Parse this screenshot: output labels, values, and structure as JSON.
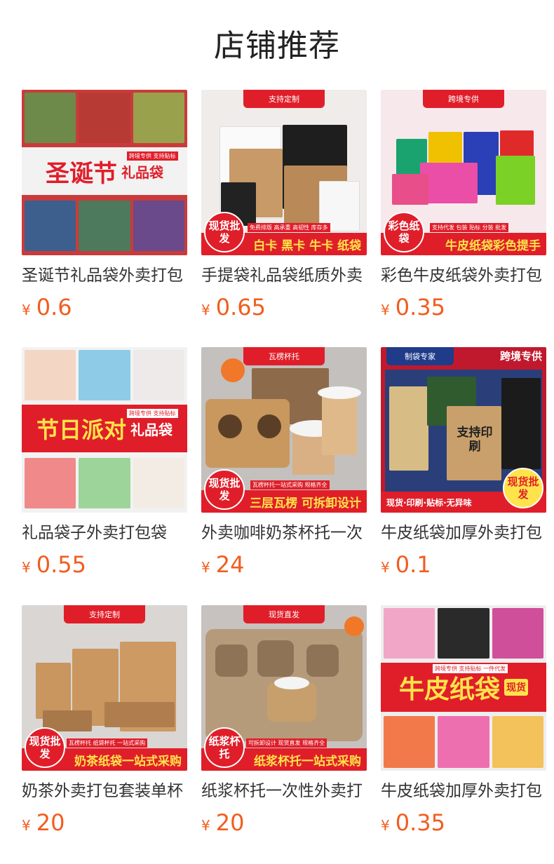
{
  "section": {
    "title": "店铺推荐"
  },
  "currency_symbol": "¥",
  "colors": {
    "price": "#f25d1e",
    "brand_red": "#e01e2a"
  },
  "products": [
    {
      "title": "圣诞节礼品袋外卖打包",
      "price": "0.6",
      "image": {
        "banner": "圣诞节",
        "sub": "礼品袋",
        "tag": "跨境专供 支持贴标"
      }
    },
    {
      "title": "手提袋礼品袋纸质外卖",
      "price": "0.65",
      "image": {
        "top": "支持定制",
        "badge": "现货批发",
        "strip": "白卡 黑卡 牛卡 纸袋",
        "tag": "免费排版 高承重 高韧性 库存多"
      }
    },
    {
      "title": "彩色牛皮纸袋外卖打包",
      "price": "0.35",
      "image": {
        "top": "跨境专供",
        "badge": "彩色纸袋",
        "strip": "牛皮纸袋彩色提手",
        "tag": "支持代发 包装 贴标 分装 批发"
      }
    },
    {
      "title": "礼品袋子外卖打包袋",
      "price": "0.55",
      "image": {
        "banner": "节日派对",
        "sub": "礼品袋",
        "tag": "跨境专供 支持贴标"
      }
    },
    {
      "title": "外卖咖啡奶茶杯托一次",
      "price": "24",
      "image": {
        "top": "瓦楞杯托",
        "badge": "现货批发",
        "strip": "三层瓦楞 可拆卸设计",
        "tag": "瓦楞杯托一站式采购 规格齐全"
      }
    },
    {
      "title": "牛皮纸袋加厚外卖打包",
      "price": "0.1",
      "image": {
        "top": "制袋专家",
        "corner": "跨境专供",
        "center": "支持印刷",
        "badge": "现货批发",
        "strip": "现货·印刷·贴标·无异味"
      }
    },
    {
      "title": "奶茶外卖打包套装单杯",
      "price": "20",
      "image": {
        "top": "支持定制",
        "badge": "现货批发",
        "strip": "奶茶纸袋一站式采购",
        "tag": "瓦楞杯托 纸袋杯托 一站式采购"
      }
    },
    {
      "title": "纸浆杯托一次性外卖打",
      "price": "20",
      "image": {
        "top": "现货直发",
        "badge": "纸浆杯托",
        "strip": "纸浆杯托一站式采购",
        "tag": "可拆卸设计 现货直发 规格齐全"
      }
    },
    {
      "title": "牛皮纸袋加厚外卖打包",
      "price": "0.35",
      "image": {
        "banner": "牛皮纸袋",
        "sub": "现货",
        "tag": "跨境专供 支持贴标 一件代发"
      }
    }
  ]
}
